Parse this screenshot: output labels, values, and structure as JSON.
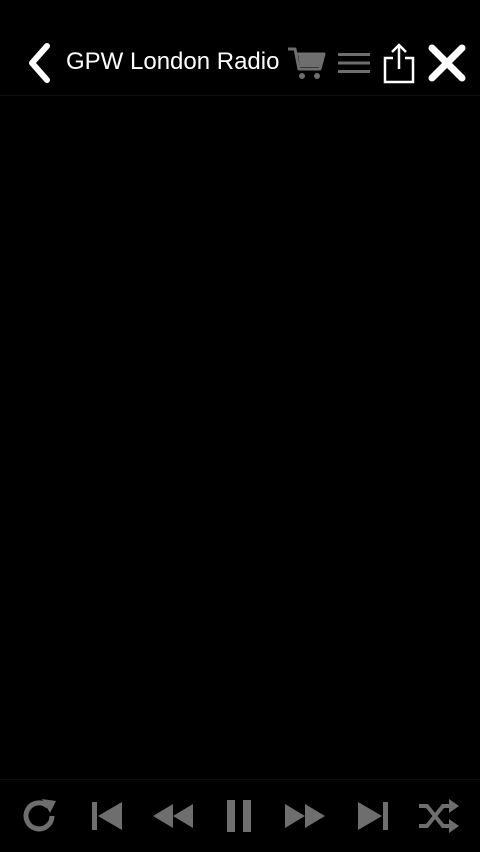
{
  "header": {
    "title": "GPW London Radio",
    "icons": {
      "back": "chevron-left-icon",
      "cart": "cart-icon",
      "menu": "hamburger-menu-icon",
      "share": "share-icon",
      "close": "close-icon"
    }
  },
  "player": {
    "controls": [
      "repeat-icon",
      "skip-previous-icon",
      "rewind-icon",
      "pause-icon",
      "fast-forward-icon",
      "skip-next-icon",
      "shuffle-icon"
    ]
  },
  "colors": {
    "background": "#000000",
    "title_text": "#ffffff",
    "active_icon": "#ffffff",
    "muted_icon": "#6e6e6e"
  }
}
